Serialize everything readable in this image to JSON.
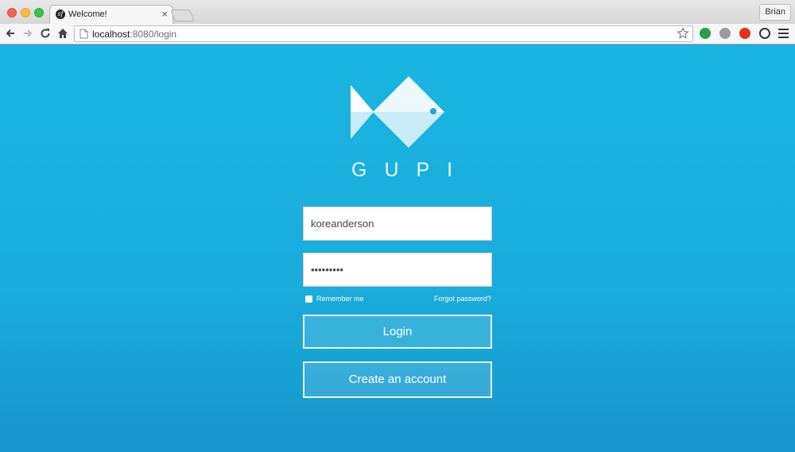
{
  "browser": {
    "tab_title": "Welcome!",
    "tab_favicon": "sf",
    "tab_close": "×",
    "profile_name": "Brian",
    "url_host": "localhost",
    "url_path": ":8080/login"
  },
  "icons": {
    "back": "back-arrow-icon",
    "forward": "forward-arrow-icon",
    "reload": "reload-icon",
    "home": "home-icon",
    "bookmark": "star-icon",
    "menu": "hamburger-menu-icon"
  },
  "login": {
    "brand": "GUPI",
    "username_value": "koreanderson",
    "password_value": "•••••••••",
    "remember_label": "Remember me",
    "forgot_label": "Forgot password?",
    "login_label": "Login",
    "create_label": "Create an account"
  },
  "colors": {
    "background": "#1aa6d7",
    "fish_light": "#eef9fd",
    "fish_accent": "#1aa6d7"
  }
}
